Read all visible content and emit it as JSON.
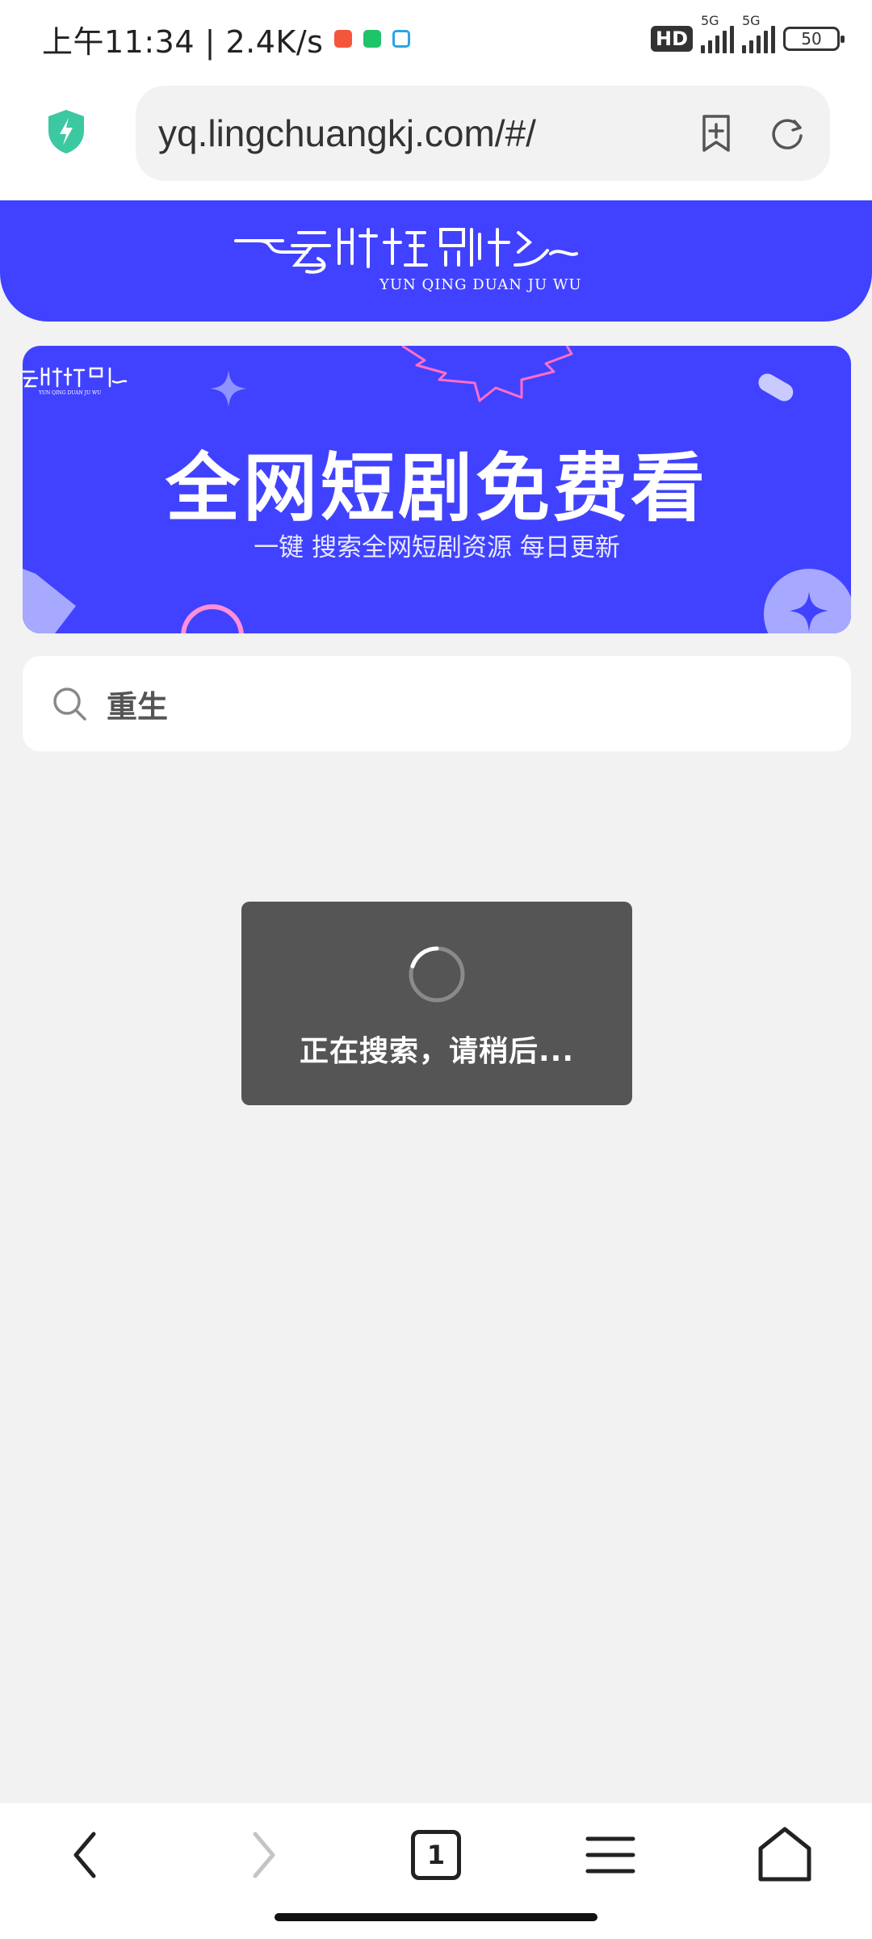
{
  "status_bar": {
    "time": "上午11:34 | 2.4K/s",
    "hd": "HD",
    "signal_label": "5G",
    "battery": "50"
  },
  "browser": {
    "url": "yq.lingchuangkj.com/#/"
  },
  "header": {
    "logo_text": "YUN QING DUAN JU WU",
    "brand_color": "#4142ff"
  },
  "banner": {
    "title": "全网短剧免费看",
    "subtitle": "一键 搜索全网短剧资源 每日更新",
    "logo_text": "YUN QING DUAN JU WU"
  },
  "search": {
    "value": "重生"
  },
  "toast": {
    "message": "正在搜索，请稍后..."
  },
  "bottom_nav": {
    "tab_count": "1"
  }
}
